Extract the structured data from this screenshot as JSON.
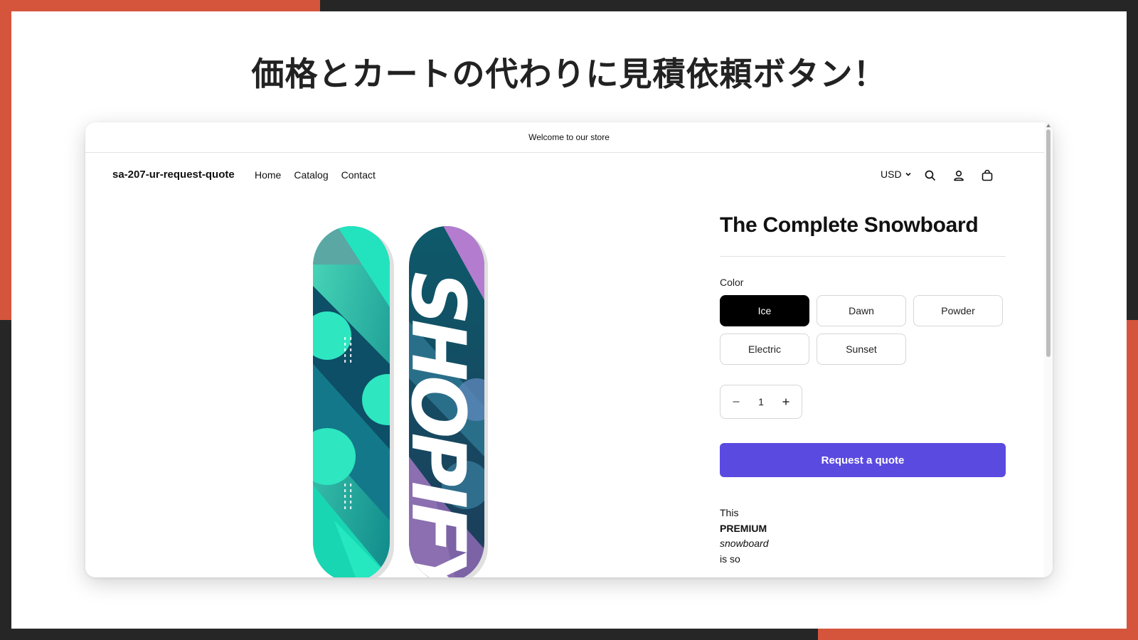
{
  "headline": "価格とカートの代わりに見積依頼ボタン！",
  "store": {
    "announcement": "Welcome to our store",
    "logo": "sa-207-ur-request-quote",
    "nav": [
      "Home",
      "Catalog",
      "Contact"
    ],
    "currency": "USD"
  },
  "product": {
    "title": "The Complete Snowboard",
    "color_label": "Color",
    "colors": [
      "Ice",
      "Dawn",
      "Powder",
      "Electric",
      "Sunset"
    ],
    "selected_color": "Ice",
    "quantity": "1",
    "quote_button": "Request a quote",
    "board_graphic_text": "SHOPIFY",
    "description": {
      "line1": "This",
      "line2": "PREMIUM",
      "line3": "snowboard",
      "line4": "is so"
    }
  },
  "colors": {
    "accent": "#d4553b",
    "button": "#5b4ae0",
    "frame": "#262626"
  },
  "icons": [
    "chevron-down-icon",
    "search-icon",
    "account-icon",
    "cart-icon",
    "minus-icon",
    "plus-icon"
  ]
}
